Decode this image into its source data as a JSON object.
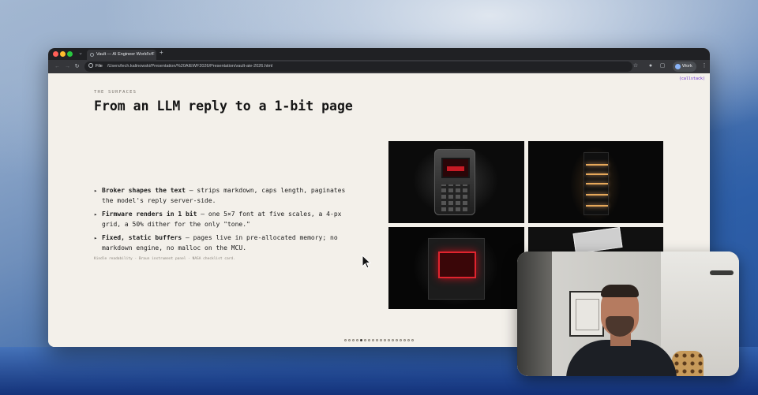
{
  "browser": {
    "tab_title": "Vault — AI Engineer World's F",
    "url_protocol": "File",
    "url": "/Users/lech.kalinowski/Presentation/%20AIEWF2026/Presentation/vault-aie-2026.html",
    "profile_label": "Work"
  },
  "slide": {
    "watermark": "(callstack)",
    "eyebrow": "THE SURFACES",
    "title": "From an LLM reply to a 1-bit page",
    "bullets": [
      {
        "bold": "Broker shapes the text",
        "text": " — strips markdown, caps length, paginates the model's reply server-side."
      },
      {
        "bold": "Firmware renders in 1 bit",
        "text": " — one 5×7 font at five scales, a 4-px grid, a 50% dither for the only \"tone.\""
      },
      {
        "bold": "Fixed, static buffers",
        "text": " — pages live in pre-allocated memory; no markdown engine, no malloc on the MCU."
      }
    ],
    "caption": "Kindle readability · Braun instrument panel · NASA checklist card.",
    "images": [
      {
        "name": "handheld terminal device with red screen"
      },
      {
        "name": "glowing rack of lit slots"
      },
      {
        "name": "dark box with red-lit screen"
      },
      {
        "name": "hand holding a printed card"
      }
    ],
    "pagination": {
      "total": 18,
      "active": 5
    }
  },
  "colors": {
    "slide_bg": "#f3f0ea",
    "title": "#141414",
    "watermark": "#6a2fcf",
    "chrome_dark": "#202124"
  }
}
